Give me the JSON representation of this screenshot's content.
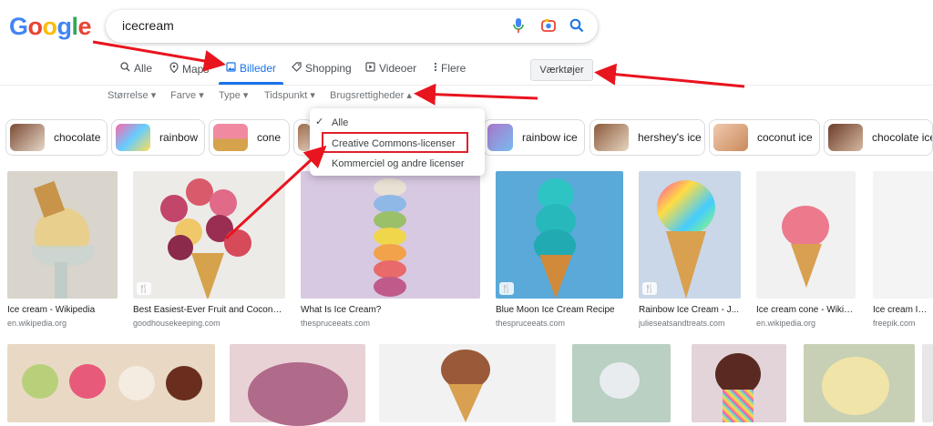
{
  "logo": {
    "letters": [
      "G",
      "o",
      "o",
      "g",
      "l",
      "e"
    ],
    "colors": [
      "#4285f4",
      "#ea4335",
      "#fbbc05",
      "#4285f4",
      "#34a853",
      "#ea4335"
    ]
  },
  "search": {
    "query": "icecream",
    "icons": [
      "microphone-icon",
      "camera-lens-icon",
      "search-icon"
    ]
  },
  "tabs": [
    {
      "label": "Alle",
      "icon": "search"
    },
    {
      "label": "Maps",
      "icon": "map-pin"
    },
    {
      "label": "Billeder",
      "icon": "image"
    },
    {
      "label": "Shopping",
      "icon": "tag"
    },
    {
      "label": "Videoer",
      "icon": "play"
    },
    {
      "label": "Flere",
      "icon": "more"
    }
  ],
  "tools_label": "Værktøjer",
  "filters": [
    {
      "label": "Størrelse"
    },
    {
      "label": "Farve"
    },
    {
      "label": "Type"
    },
    {
      "label": "Tidspunkt"
    },
    {
      "label": "Brugsrettigheder"
    }
  ],
  "chips": [
    {
      "label": "chocolate",
      "color": "#a0664a"
    },
    {
      "label": "rainbow",
      "color": "#d46fb0"
    },
    {
      "label": "cone",
      "color": "#e88a9a"
    },
    {
      "label": "rainbow ice",
      "color": "#8aa6e0"
    },
    {
      "label": "hershey's ice",
      "color": "#8b5a3c"
    },
    {
      "label": "coconut ice",
      "color": "#c98a5a"
    },
    {
      "label": "chocolate ice",
      "color": "#6b3d2a"
    }
  ],
  "dropdown": {
    "items": [
      {
        "label": "Alle",
        "checked": true
      },
      {
        "label": "Creative Commons-licenser",
        "checked": false
      },
      {
        "label": "Kommerciel og andre licenser",
        "checked": false
      }
    ]
  },
  "results": [
    {
      "caption": "Ice cream - Wikipedia",
      "source": "en.wikipedia.org",
      "bg": "#d9d4cc"
    },
    {
      "caption": "Best Easiest-Ever Fruit and Coconut...",
      "source": "goodhousekeeping.com",
      "bg": "#ecebe8"
    },
    {
      "caption": "What Is Ice Cream?",
      "source": "thespruceeats.com",
      "bg": "#d8c9e2"
    },
    {
      "caption": "Blue Moon Ice Cream Recipe",
      "source": "thespruceeats.com",
      "bg": "#5aa9d9"
    },
    {
      "caption": "Rainbow Ice Cream - J...",
      "source": "julieseatsandtreats.com",
      "bg": "#c9d7e8"
    },
    {
      "caption": "Ice cream cone - Wikip...",
      "source": "en.wikipedia.org",
      "bg": "#f1f1f1"
    },
    {
      "caption": "Ice cream Imag",
      "source": "freepik.com",
      "bg": "#f4f4f4"
    }
  ],
  "row2": [
    {
      "bg": "#e9d9c4"
    },
    {
      "bg": "#e8d2d6"
    },
    {
      "bg": "#f2f2f2"
    },
    {
      "bg": "#b9d0c2"
    },
    {
      "bg": "#e3d4d9"
    },
    {
      "bg": "#c7d0b5"
    },
    {
      "bg": "#e7e7e7"
    }
  ],
  "annotation_color": "#e8141e"
}
